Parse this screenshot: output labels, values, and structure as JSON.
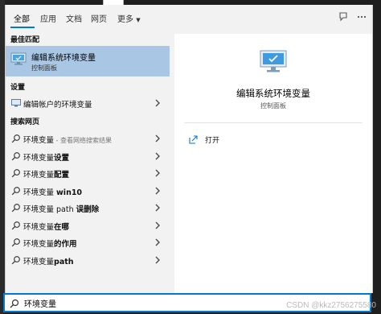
{
  "tabs": [
    {
      "label": "全部"
    },
    {
      "label": "应用"
    },
    {
      "label": "文档"
    },
    {
      "label": "网页"
    },
    {
      "label": "更多"
    }
  ],
  "toolbar_icons": [
    "feedback-icon",
    "more-options-icon"
  ],
  "sections": {
    "best_match": "最佳匹配",
    "settings": "设置",
    "web": "搜索网页"
  },
  "best_match": {
    "title": "编辑系统环境变量",
    "subtitle": "控制面板"
  },
  "settings_items": [
    {
      "label": "编辑帐户的环境变量"
    }
  ],
  "web_items": [
    {
      "plain": "环境变量",
      "bold": "",
      "dim": " - 查看网络搜索结果"
    },
    {
      "plain": "环境变量",
      "bold": "设置",
      "dim": ""
    },
    {
      "plain": "环境变量",
      "bold": "配置",
      "dim": ""
    },
    {
      "plain": "环境变量 ",
      "bold": "win10",
      "dim": ""
    },
    {
      "plain": "环境变量 path ",
      "bold": "误删除",
      "dim": ""
    },
    {
      "plain": "环境变量",
      "bold": "在哪",
      "dim": ""
    },
    {
      "plain": "环境变量",
      "bold": "的作用",
      "dim": ""
    },
    {
      "plain": "环境变量",
      "bold": "path",
      "dim": ""
    }
  ],
  "preview": {
    "title": "编辑系统环境变量",
    "subtitle": "控制面板",
    "action": "打开"
  },
  "search": {
    "value": "环境变量"
  },
  "watermark": "CSDN @kkz2756275580",
  "colors": {
    "accent": "#0078d7",
    "selected": "#a9c7e4"
  }
}
